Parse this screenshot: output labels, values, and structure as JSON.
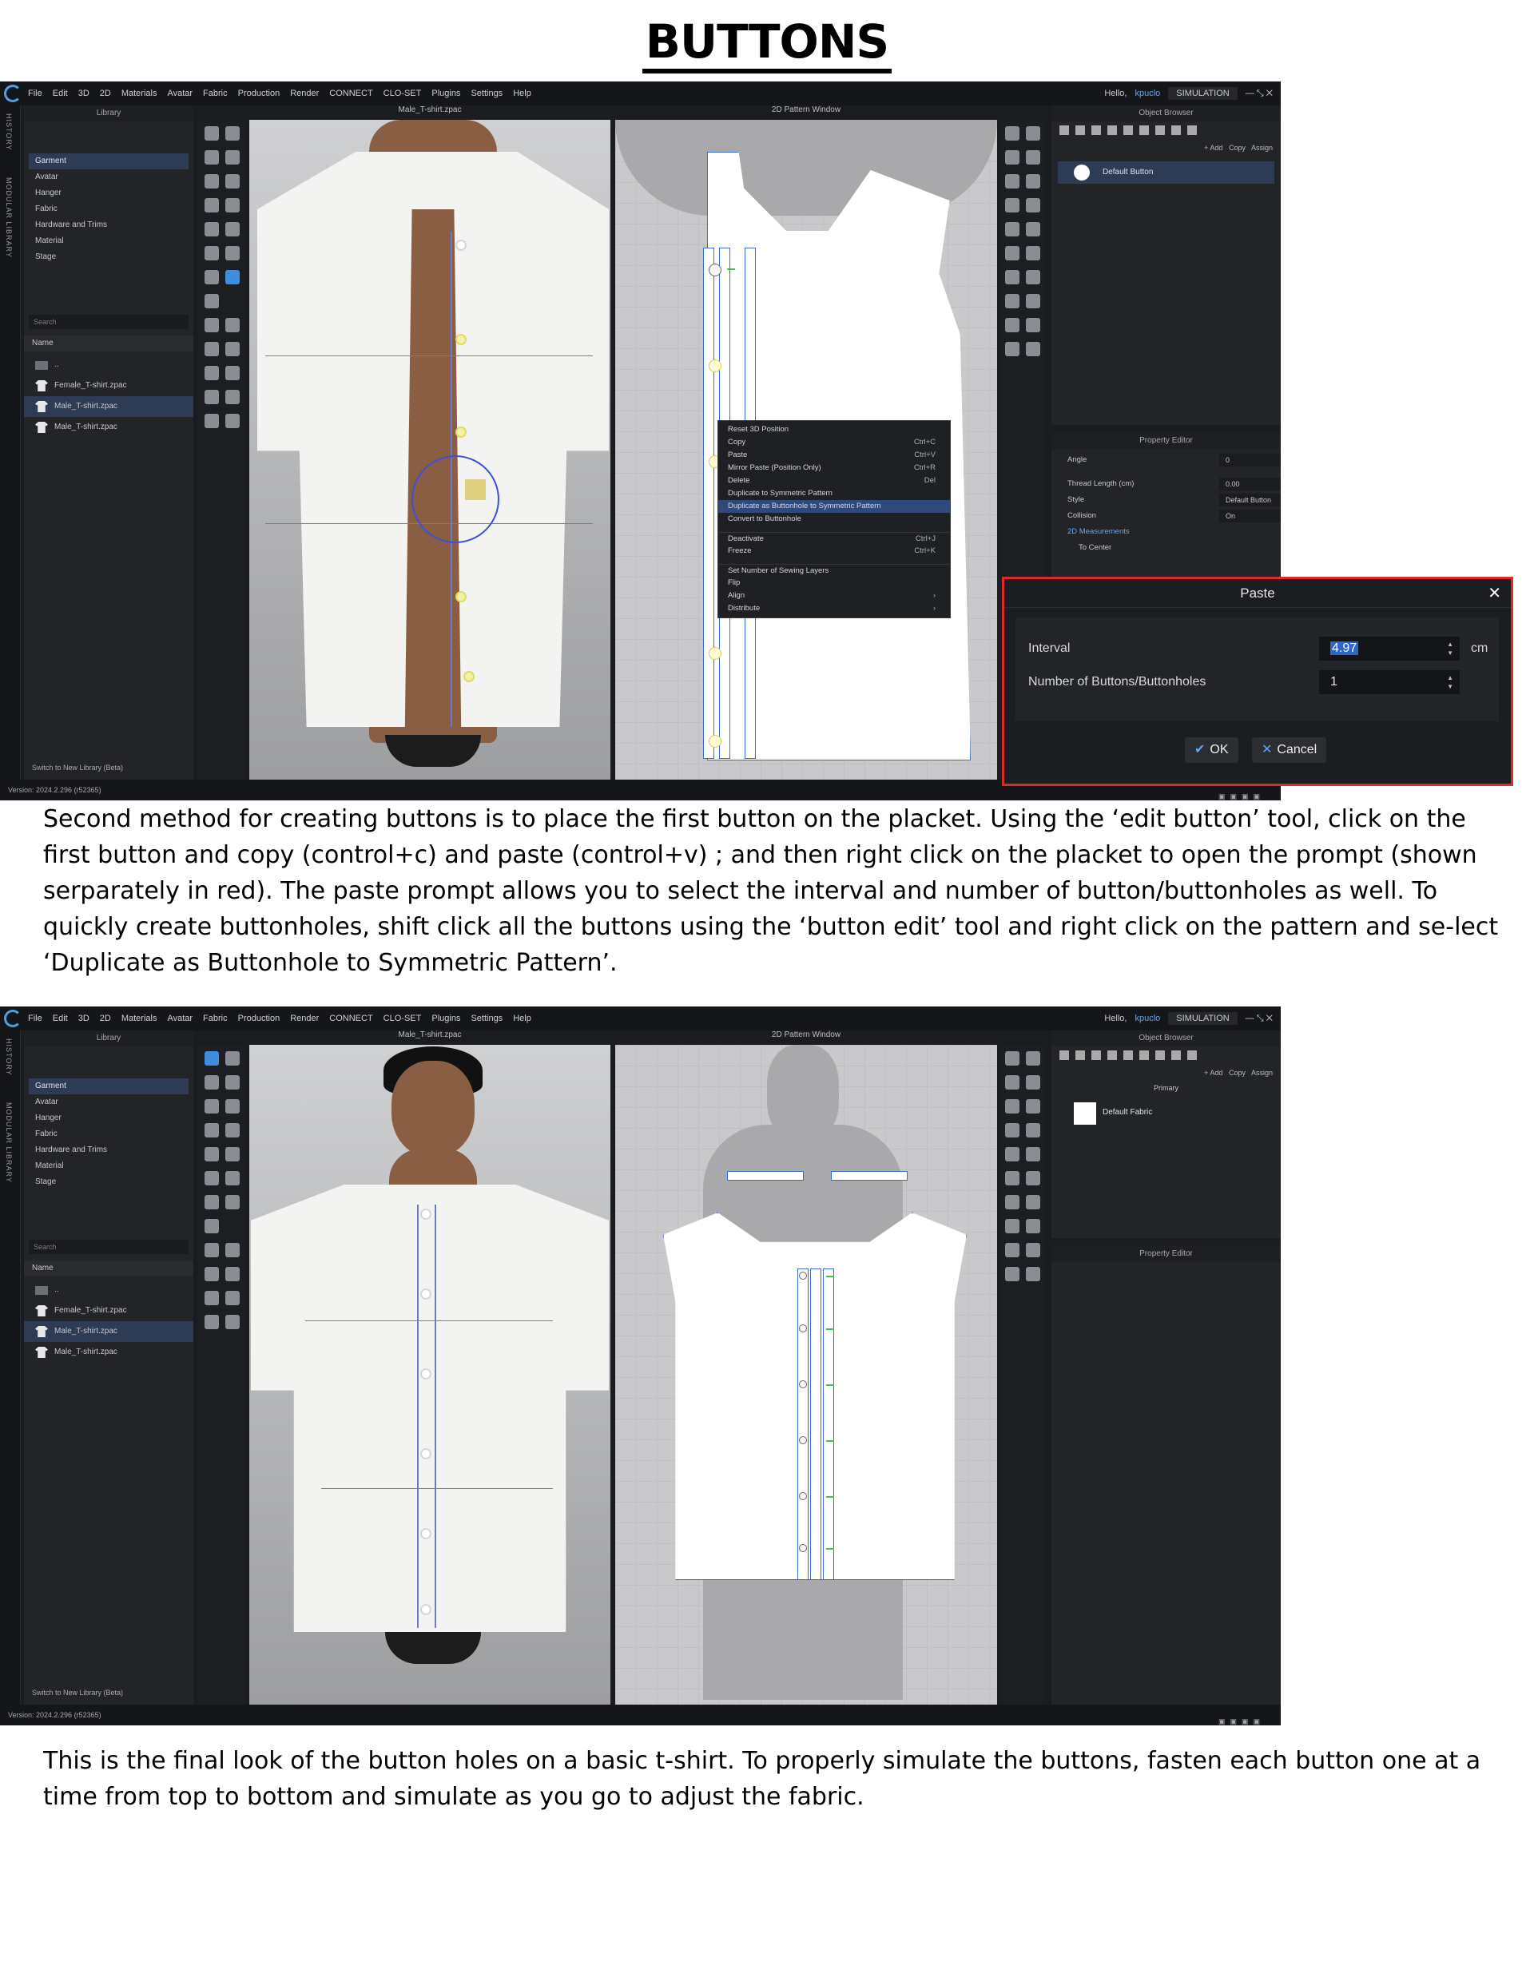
{
  "title": "BUTTONS",
  "paragraph1": "Second method for creating buttons is to place the first button on the placket. Using the ‘edit button’ tool, click on the first button and copy (control+c) and paste (control+v) ; and then right click on the placket to open the prompt (shown serparately in red). The paste prompt allows you to select the interval and number of button/buttonholes as well. To quickly create buttonholes, shift click all the buttons using the ‘button edit’ tool and right click on the pattern and se-lect  ‘Duplicate as Buttonhole to Symmetric Pattern’.",
  "paragraph2": "This is the final look of the button holes on a basic t-shirt. To properly simulate the buttons, fasten each button one at a time from top to bottom and simulate as you go to adjust the fabric.",
  "menu": [
    "File",
    "Edit",
    "3D",
    "2D",
    "Materials",
    "Avatar",
    "Fabric",
    "Production",
    "Render",
    "CONNECT",
    "CLO-SET",
    "Plugins",
    "Settings",
    "Help"
  ],
  "hello": "Hello,",
  "username": "kpuclo",
  "simulation": "SIMULATION",
  "vtabs": {
    "history": "HISTORY",
    "modular": "MODULAR LIBRARY"
  },
  "library": {
    "title": "Library",
    "tree": [
      "Garment",
      "Avatar",
      "Hanger",
      "Fabric",
      "Hardware and Trims",
      "Material",
      "Stage"
    ],
    "search": "Search",
    "name_header": "Name",
    "items": [
      "..",
      "Female_T-shirt.zpac",
      "Male_T-shirt.zpac",
      "Male_T-shirt.zpac"
    ],
    "switch": "Switch to New Library (Beta)"
  },
  "view3d_title": "Male_T-shirt.zpac",
  "view2d_title": "2D Pattern Window",
  "object_browser": {
    "title": "Object Browser",
    "add": "+ Add",
    "copy": "Copy",
    "assign": "Assign",
    "item1": "Default Button",
    "primary": "Primary",
    "item2": "Default Fabric"
  },
  "property_editor": {
    "title": "Property Editor",
    "rows": [
      {
        "label": "Angle",
        "value": "0"
      },
      {
        "label": "Thread Length (cm)",
        "value": "0.00"
      },
      {
        "label": "Style",
        "value": "Default Button"
      },
      {
        "label": "Collision",
        "value": "On"
      }
    ],
    "measurements": "2D Measurements",
    "to_center": "To Center"
  },
  "context_menu": [
    {
      "label": "Reset 3D Position",
      "shortcut": ""
    },
    {
      "label": "Copy",
      "shortcut": "Ctrl+C"
    },
    {
      "label": "Paste",
      "shortcut": "Ctrl+V"
    },
    {
      "label": "Mirror Paste (Position Only)",
      "shortcut": "Ctrl+R"
    },
    {
      "label": "Delete",
      "shortcut": "Del"
    },
    {
      "label": "Duplicate to Symmetric Pattern",
      "shortcut": ""
    },
    {
      "label": "Duplicate as Buttonhole to Symmetric Pattern",
      "shortcut": "",
      "highlight": true
    },
    {
      "label": "Convert to Buttonhole",
      "shortcut": ""
    },
    {
      "label": "Deactivate",
      "shortcut": "Ctrl+J",
      "sep": true
    },
    {
      "label": "Freeze",
      "shortcut": "Ctrl+K"
    },
    {
      "label": "Set Number of Sewing Layers",
      "shortcut": "",
      "sep": true
    },
    {
      "label": "Flip",
      "shortcut": ""
    },
    {
      "label": "Align",
      "shortcut": "›"
    },
    {
      "label": "Distribute",
      "shortcut": "›"
    }
  ],
  "paste_dialog": {
    "title": "Paste",
    "interval_label": "Interval",
    "interval_value": "4.97",
    "unit": "cm",
    "number_label": "Number of Buttons/Buttonholes",
    "number_value": "1",
    "ok": "OK",
    "cancel": "Cancel"
  },
  "version": "Version: 2024.2.296 (r52365)",
  "colors": {
    "accent": "#5aa8ff",
    "highlight_border": "#e02a2a",
    "app_bg": "#1b1c20"
  }
}
